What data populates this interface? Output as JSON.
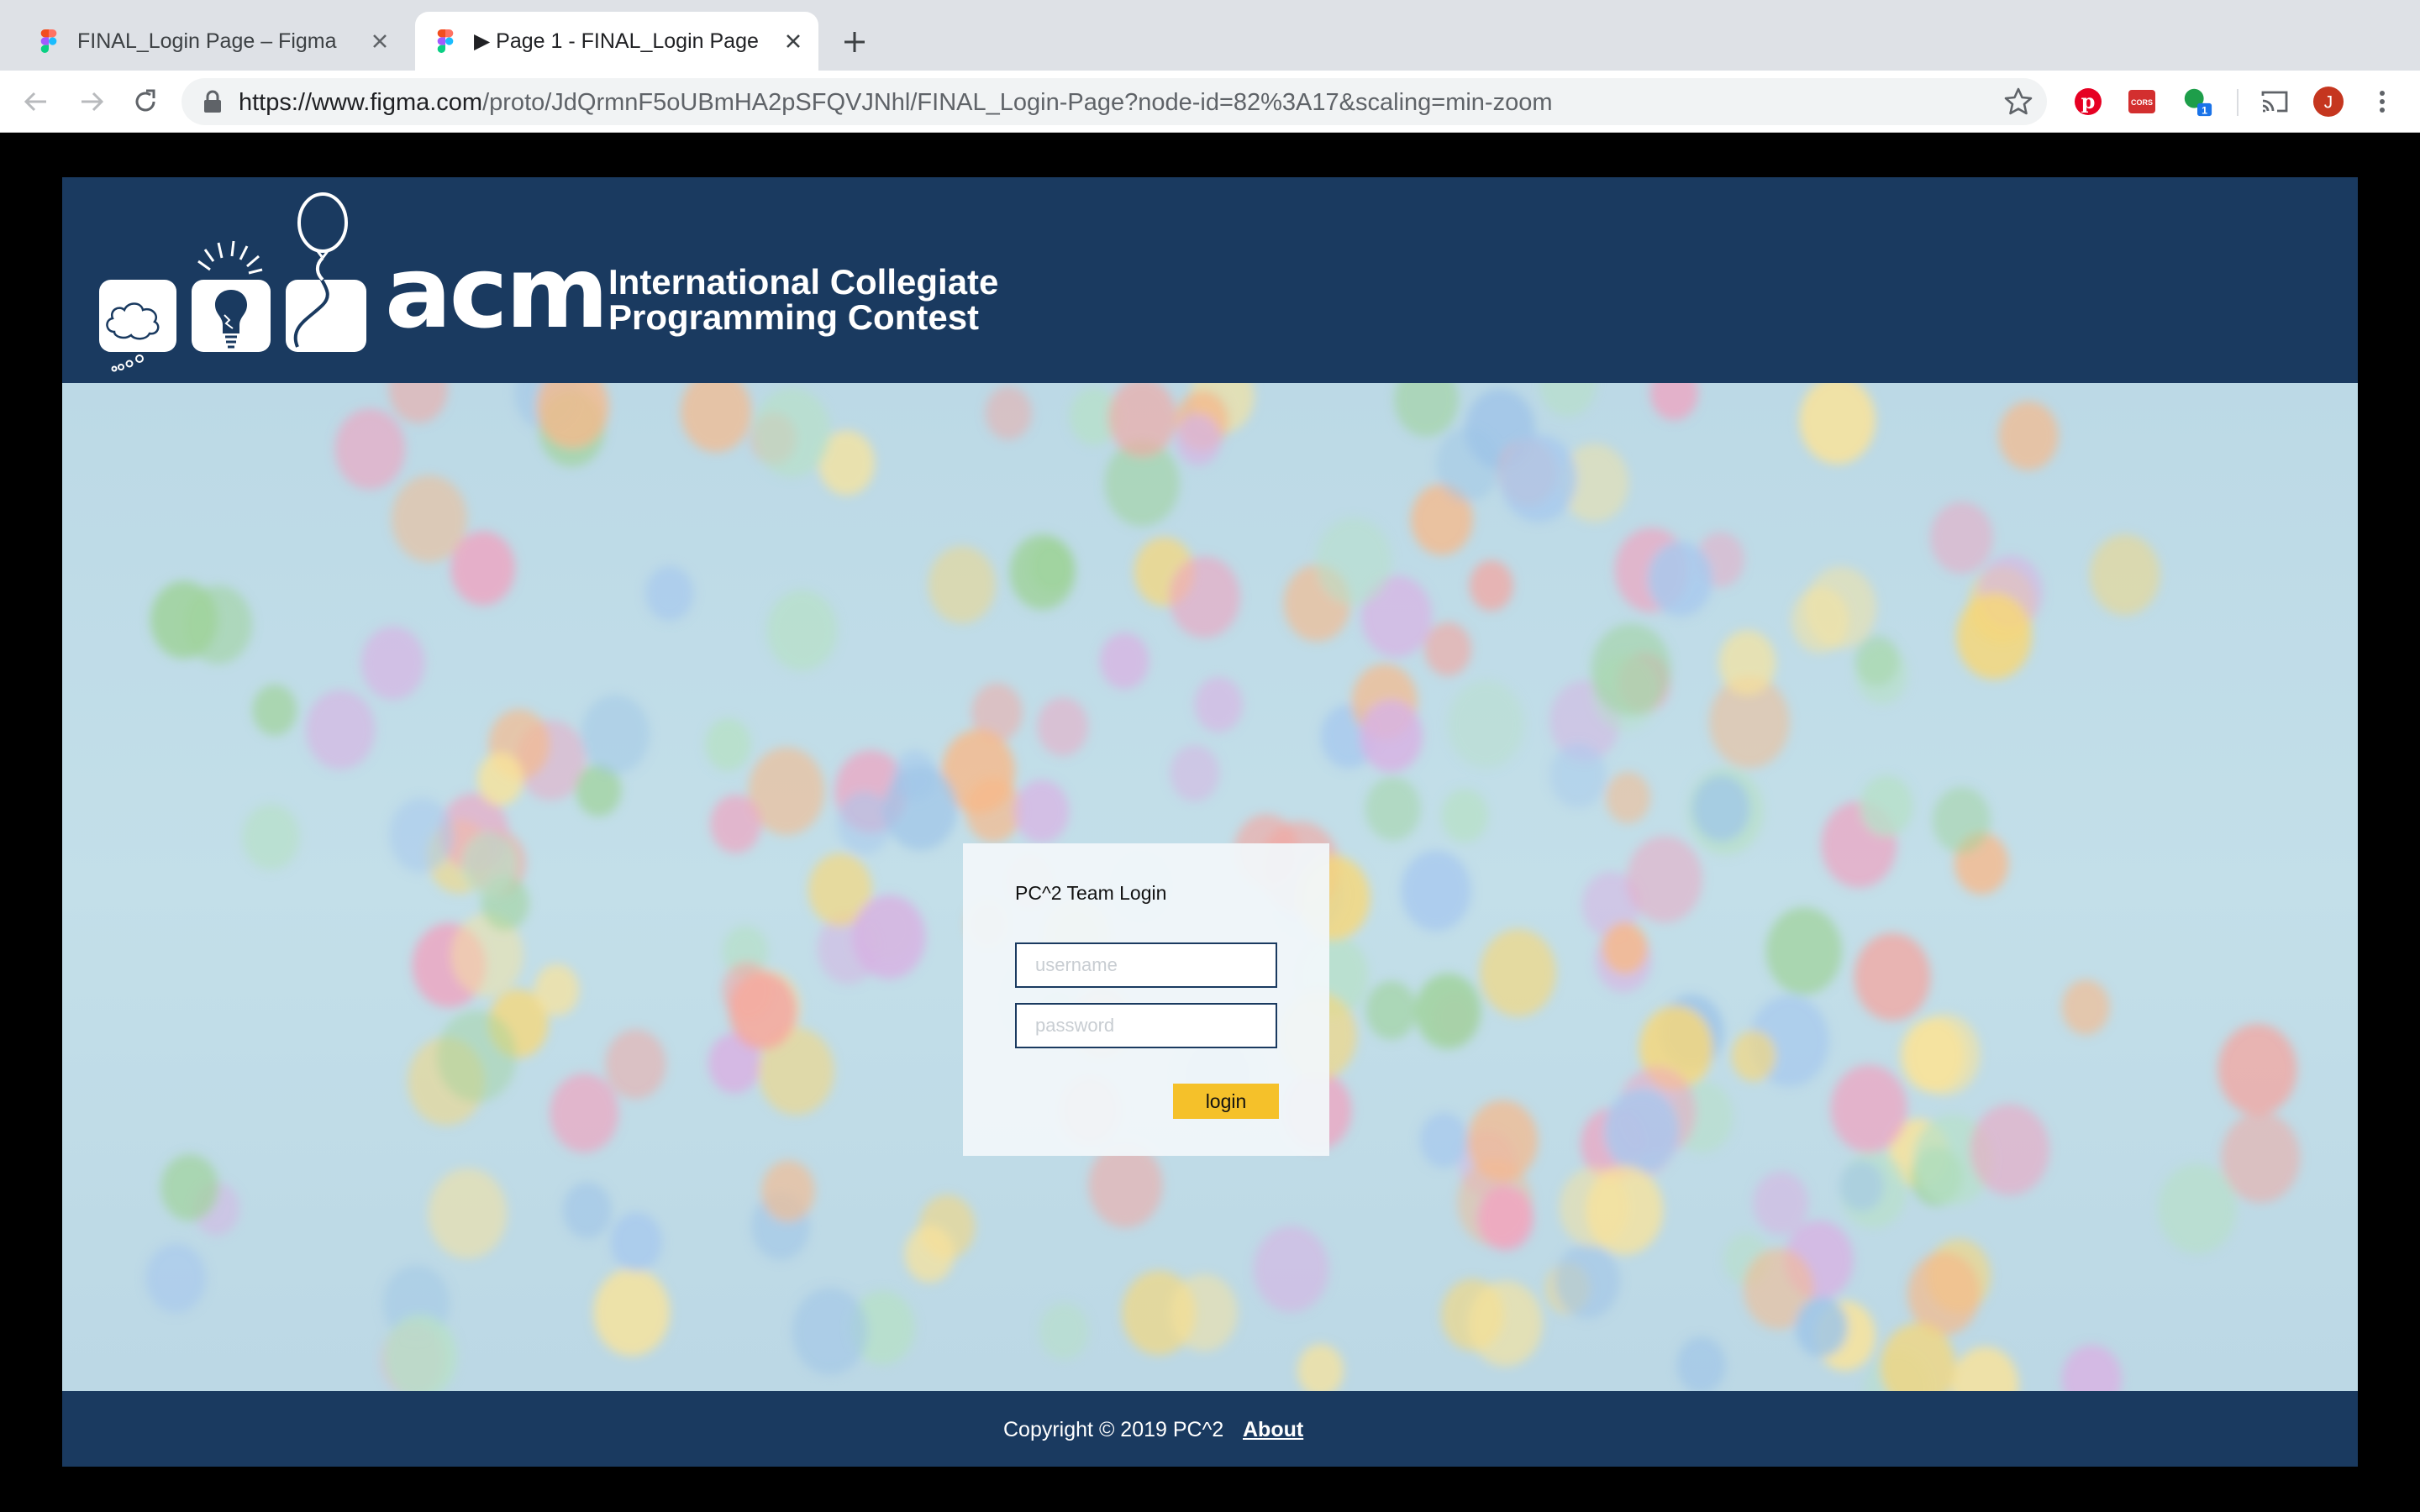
{
  "browser": {
    "tabs": [
      {
        "title": "FINAL_Login Page – Figma",
        "active": false
      },
      {
        "title": "▶ Page 1 - FINAL_Login Page",
        "active": true
      }
    ],
    "url_host": "https://www.figma.com",
    "url_path": "/proto/JdQrmnF5oUBmHA2pSFQVJNhl/FINAL_Login-Page?node-id=82%3A17&scaling=min-zoom",
    "extensions": [
      "pinterest-icon",
      "cors-icon",
      "status-dot-icon",
      "cast-icon",
      "profile-avatar",
      "menu-icon"
    ],
    "cors_label": "CORS",
    "ext_badge": "1",
    "profile_initial": "J"
  },
  "header": {
    "logo_text": "acm",
    "tagline_line1": "International Collegiate",
    "tagline_line2": "Programming Contest"
  },
  "login": {
    "title": "PC^2 Team Login",
    "username_placeholder": "username",
    "password_placeholder": "password",
    "button_label": "login"
  },
  "footer": {
    "copyright": "Copyright © 2019 PC^2",
    "about_label": "About"
  },
  "colors": {
    "brand_navy": "#1a3a60",
    "accent_yellow": "#f5c12a"
  }
}
